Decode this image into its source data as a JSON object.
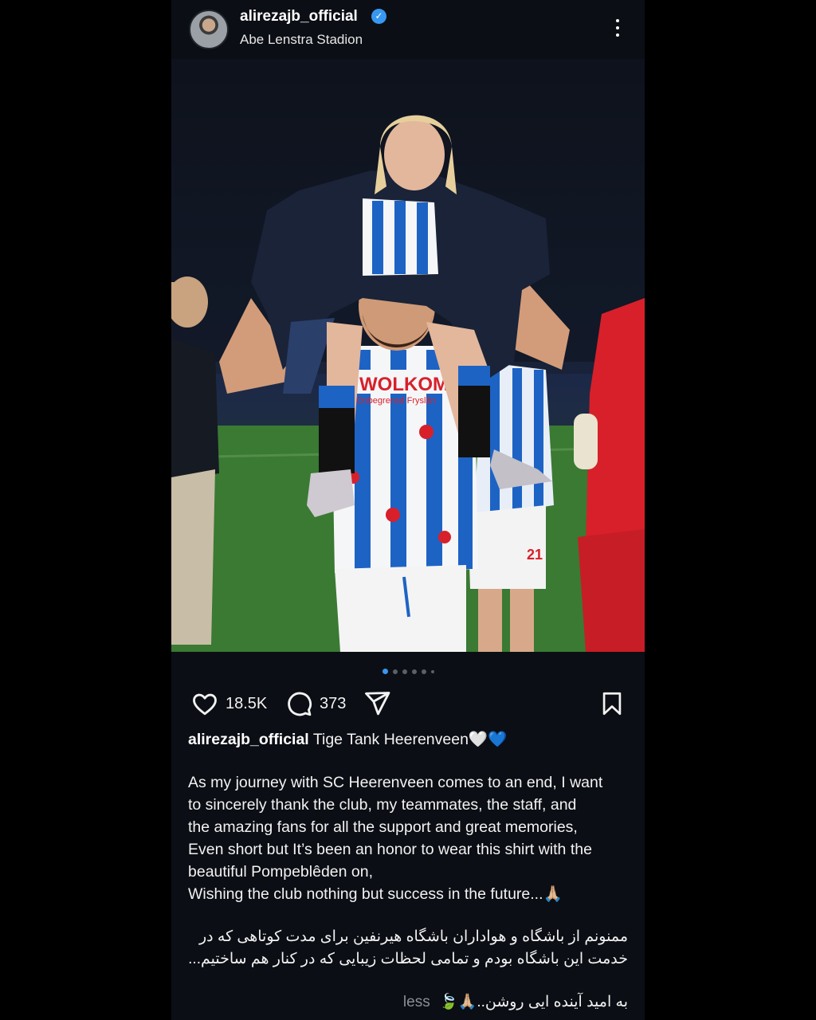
{
  "post": {
    "username": "alirezajb_official",
    "location": "Abe Lenstra Stadion",
    "likes": "18.5K",
    "comments": "373",
    "photo_texts": {
      "shirt_sponsor": "WOLKOM",
      "shirt_sub": "Onbegrensd Fryslân",
      "kit_number": "21"
    },
    "carousel": {
      "total": 6,
      "active_index": 0
    },
    "caption": {
      "username": "alirezajb_official",
      "headline": "Tige Tank Heerenveen🤍💙",
      "english_lines": [
        "As my journey with SC Heerenveen comes to an end, I want",
        "to sincerely thank the club, my teammates, the staff, and",
        "the amazing fans for all the support and great memories,",
        "Even short but It’s been an honor to wear this shirt with the",
        "beautiful Pompeblêden on,",
        "Wishing the club nothing but success in the future...🙏🏼"
      ],
      "persian_lines": [
        "ممنونم از باشگاه و هواداران باشگاه هیرنفین برای مدت کوتاهی که در",
        "خدمت این باشگاه بودم و تمامی لحظات زیبایی که در کنار هم ساختیم..."
      ],
      "persian_last": "به امید آینده ایی روشن..🙏🏼🍃",
      "less_label": "less"
    }
  },
  "colors": {
    "background": "#000000",
    "panel": "#0b0e14",
    "verified": "#3897f0",
    "kit_blue": "#1d63c4",
    "keeper_red": "#d8202a"
  }
}
